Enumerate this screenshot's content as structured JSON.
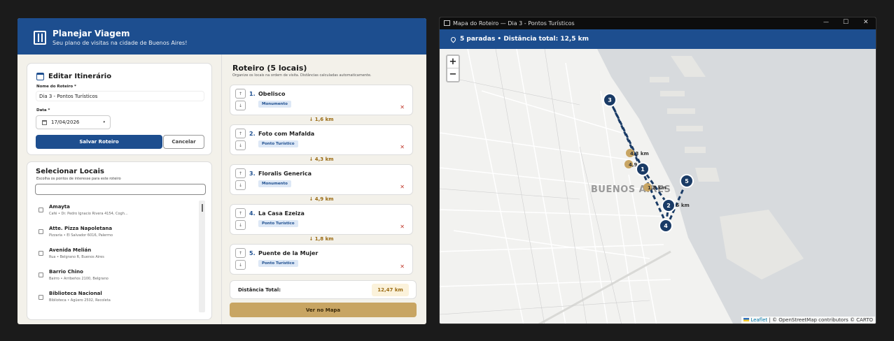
{
  "left": {
    "header": {
      "title": "Planejar Viagem",
      "subtitle": "Seu plano de visitas na cidade de Buenos Aires!"
    },
    "form": {
      "title": "Editar Itinerário",
      "name_label": "Nome do Roteiro *",
      "name_value": "Dia 3 - Pontos Turísticos",
      "date_label": "Data *",
      "date_value": "17/04/2026",
      "save_label": "Salvar Roteiro",
      "cancel_label": "Cancelar"
    },
    "select": {
      "title": "Selecionar Locais",
      "subtitle": "Escolha os pontos de interesse para este roteiro",
      "places": [
        {
          "name": "Amayta",
          "desc": "Café  •  Dr. Pedro Ignacio Rivera 4154, Cogh..."
        },
        {
          "name": "Atte. Pizza Napoletana",
          "desc": "Pizzaria  •  El Salvador 6016, Palermo"
        },
        {
          "name": "Avenida Melián",
          "desc": "Rua  •  Belgrano R, Buenos Aires"
        },
        {
          "name": "Barrio Chino",
          "desc": "Bairro  •  Arribeños 2100, Belgrano"
        },
        {
          "name": "Biblioteca Nacional",
          "desc": "Biblioteca  •  Agüero 2502, Recoleta"
        }
      ]
    },
    "route": {
      "title": "Roteiro (5 locais)",
      "subtitle": "Organize os locais na ordem de visita. Distâncias calculadas automaticamente.",
      "items": [
        {
          "num": "1.",
          "name": "Obelisco",
          "type": "Monumento"
        },
        {
          "num": "2.",
          "name": "Foto com Mafalda",
          "type": "Ponto Turístico"
        },
        {
          "num": "3.",
          "name": "Floralis Generica",
          "type": "Monumento"
        },
        {
          "num": "4.",
          "name": "La Casa Ezeiza",
          "type": "Ponto Turístico"
        },
        {
          "num": "5.",
          "name": "Puente de la Mujer",
          "type": "Ponto Turístico"
        }
      ],
      "distances": [
        "↓ 1,6 km",
        "↓ 4,3 km",
        "↓ 4,9 km",
        "↓ 1,8 km"
      ],
      "total_label": "Distância Total:",
      "total_value": "12,47 km",
      "map_button": "Ver no Mapa",
      "up_arrow": "↑",
      "down_arrow": "↓",
      "remove": "✕"
    }
  },
  "right": {
    "window_title": "Mapa do Roteiro — Dia 3 - Pontos Turísticos",
    "stats": "5 paradas  •  Distância total: 12,5 km",
    "zoom_in": "+",
    "zoom_out": "−",
    "city_label": "BUENOS AIRES",
    "markers": [
      "1",
      "2",
      "3",
      "4",
      "5"
    ],
    "dist_labels": [
      "4,3 km",
      "4,9 km",
      "1,8 km",
      "1,6 km"
    ],
    "attribution_leaflet": "Leaflet",
    "attribution_rest": " | © OpenStreetMap contributors © CARTO",
    "controls": {
      "min": "—",
      "max": "☐",
      "close": "✕"
    }
  },
  "colors": {
    "primary": "#1d4e8f",
    "accent": "#c8a563",
    "marker": "#1a3b66"
  }
}
